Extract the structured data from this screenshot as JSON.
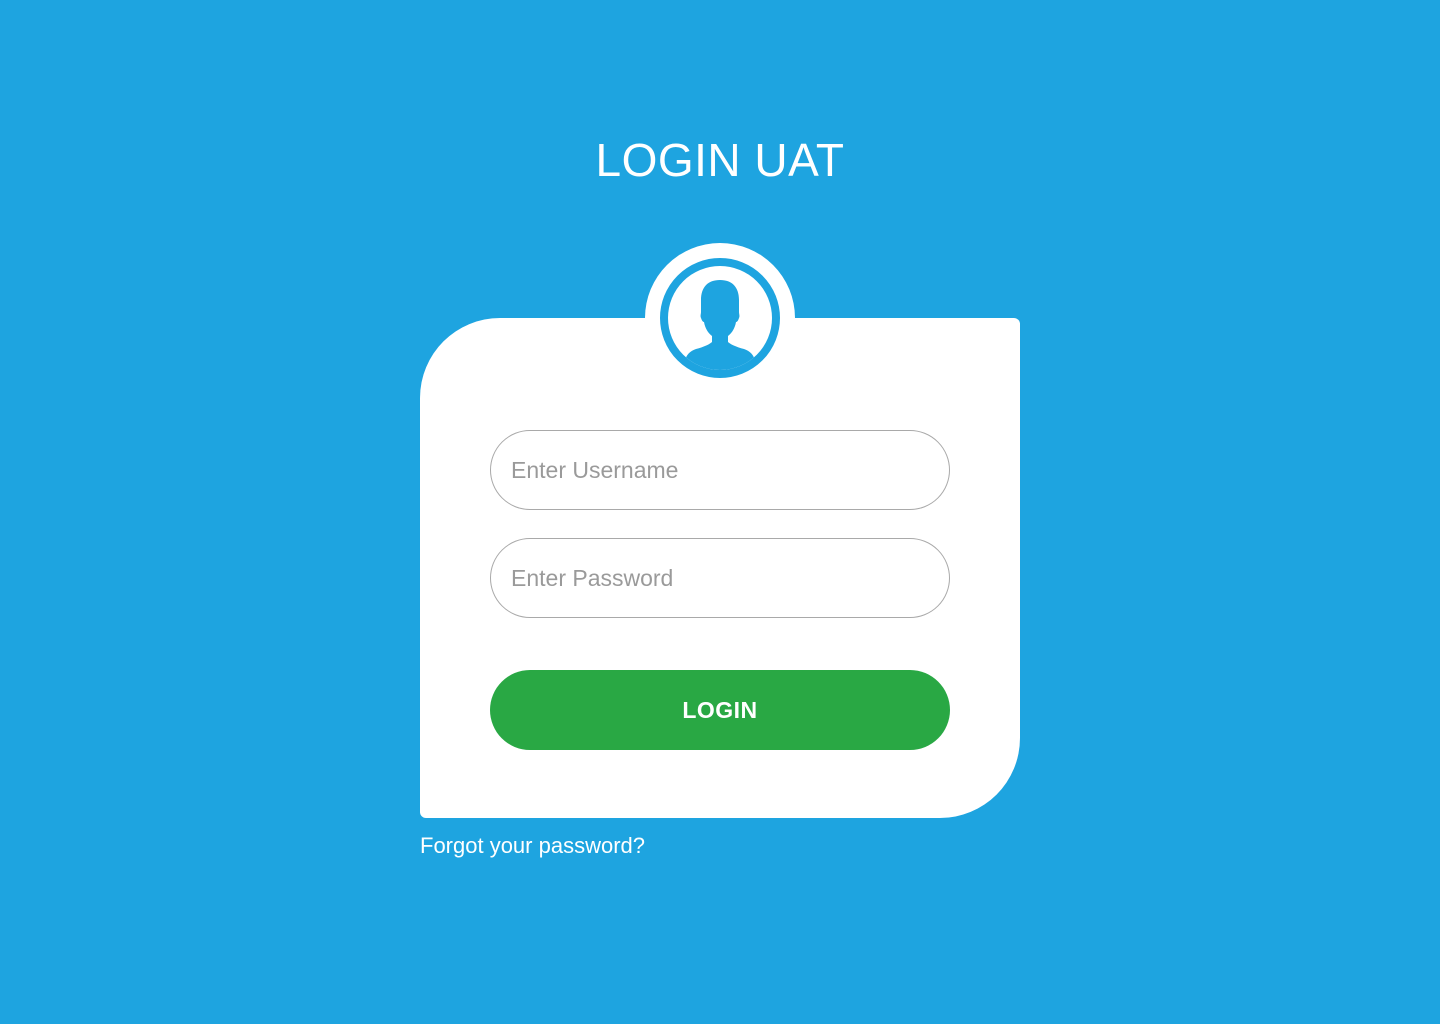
{
  "page": {
    "title": "LOGIN UAT",
    "accent_color": "#1ea4e0",
    "button_color": "#29a844"
  },
  "avatar": {
    "icon": "user-silhouette-icon"
  },
  "form": {
    "username": {
      "value": "",
      "placeholder": "Enter Username"
    },
    "password": {
      "value": "",
      "placeholder": "Enter Password"
    },
    "login_label": "LOGIN"
  },
  "links": {
    "forgot_password": "Forgot your password?"
  }
}
